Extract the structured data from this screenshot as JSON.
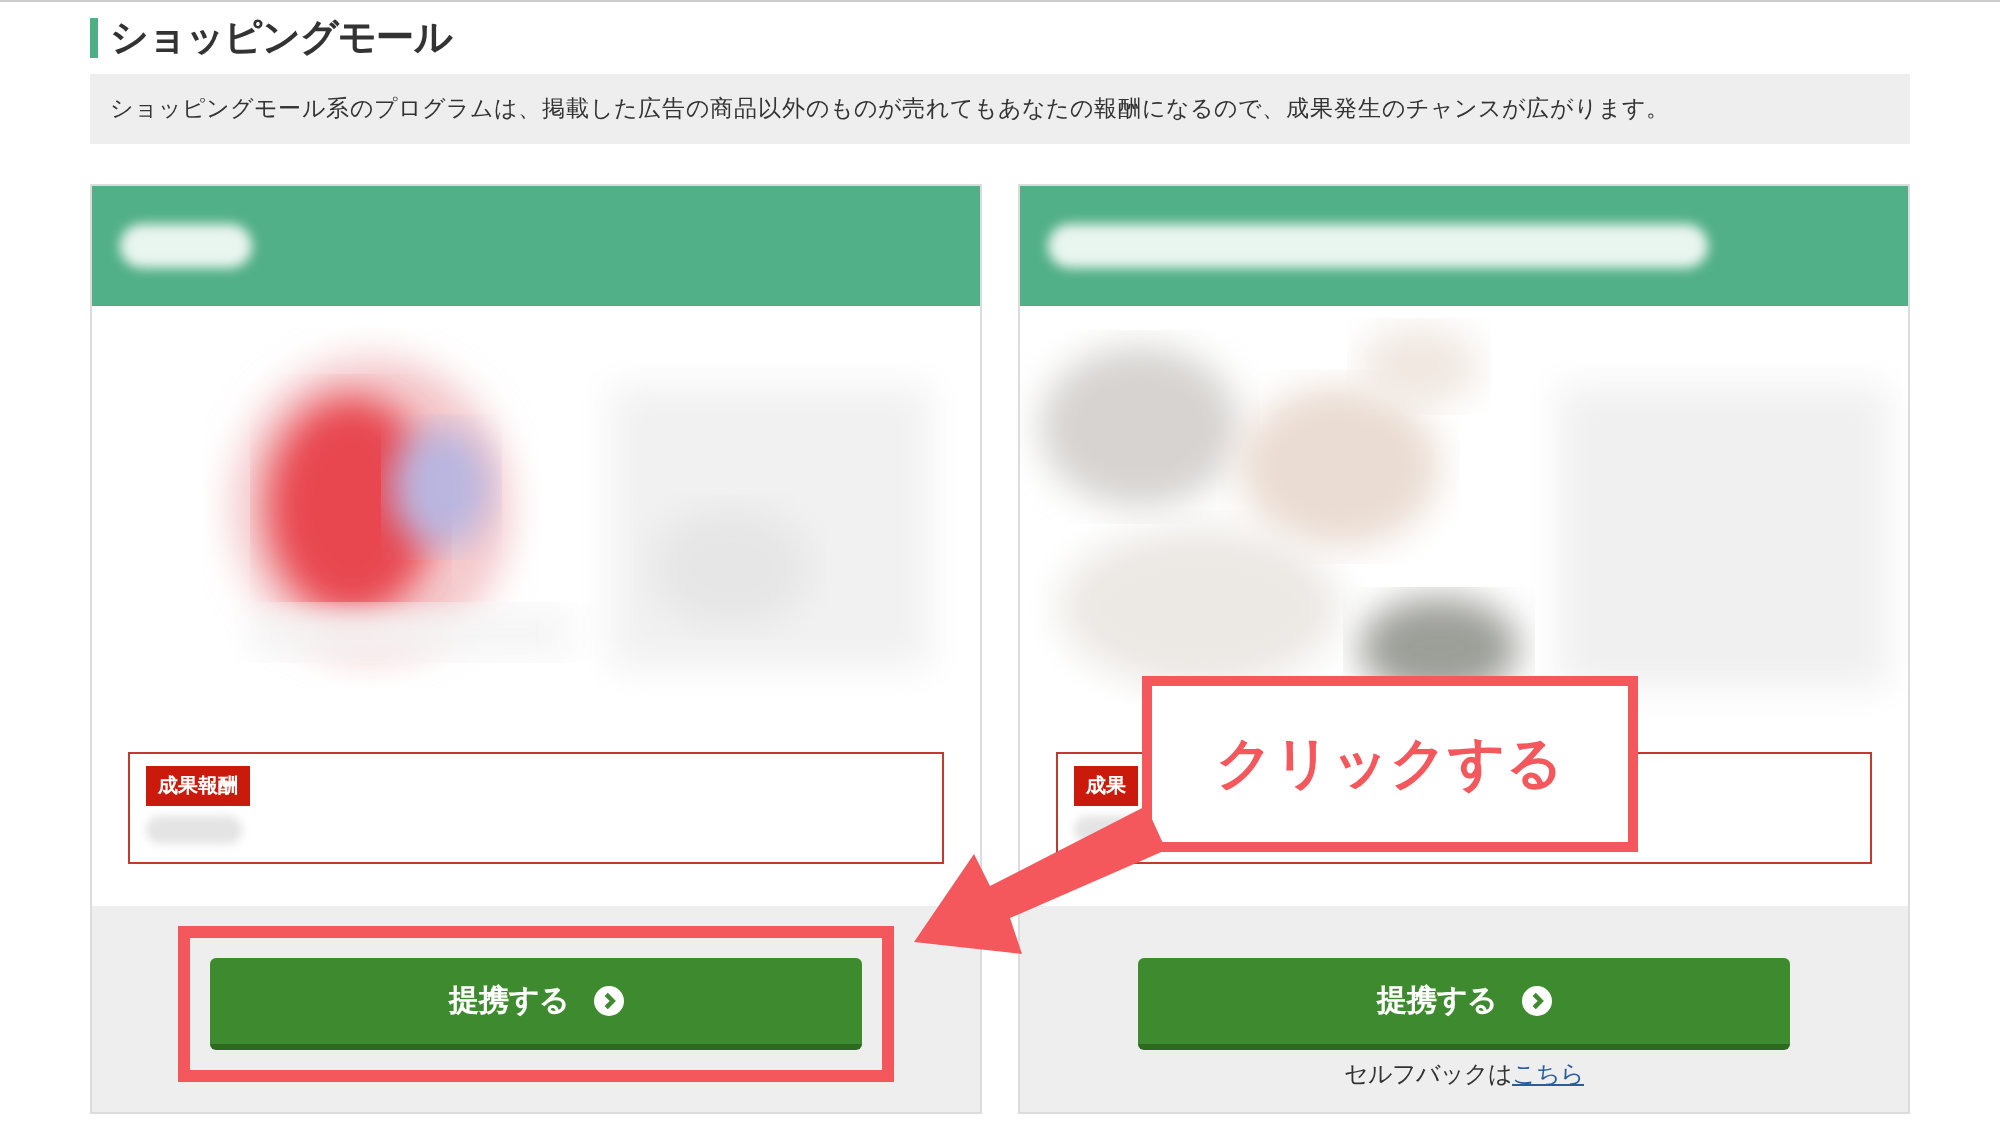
{
  "heading": "ショッピングモール",
  "description": "ショッピングモール系のプログラムは、掲載した広告の商品以外のものが売れてもあなたの報酬になるので、成果発生のチャンスが広がります。",
  "cards": [
    {
      "reward_tag": "成果報酬",
      "button": "提携する",
      "highlighted": true
    },
    {
      "reward_tag": "成果",
      "button": "提携する",
      "highlighted": false,
      "self_back": {
        "text": "セルフバックは",
        "link": "こちら"
      }
    }
  ],
  "callout": {
    "text": "クリックする"
  }
}
